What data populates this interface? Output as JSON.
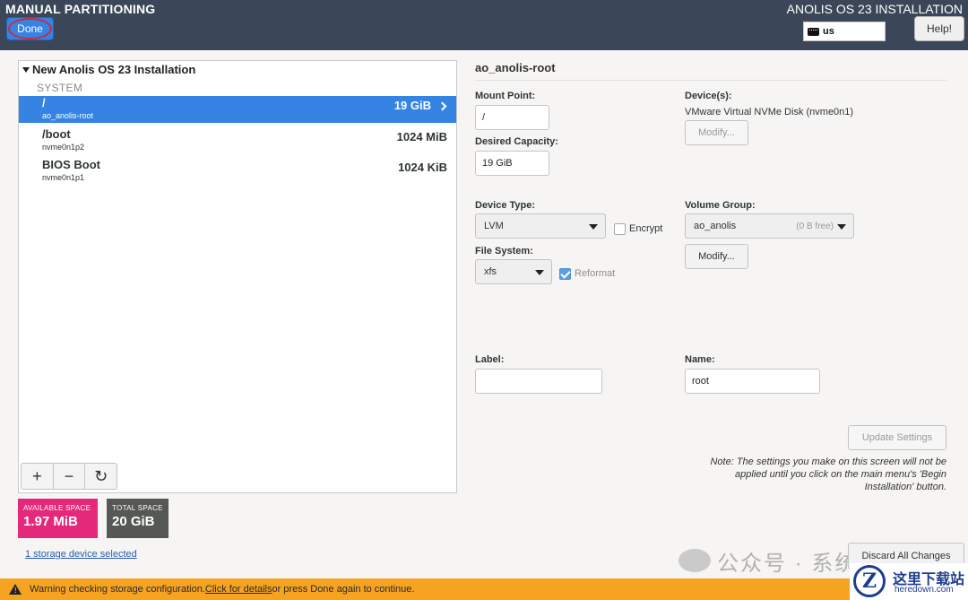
{
  "header": {
    "title": "MANUAL PARTITIONING",
    "product": "ANOLIS OS 23 INSTALLATION",
    "done_label": "Done",
    "keyboard_layout": "us",
    "help_label": "Help!"
  },
  "tree": {
    "title": "New Anolis OS 23 Installation",
    "group": "SYSTEM",
    "items": [
      {
        "mount": "/",
        "device": "ao_anolis-root",
        "size": "19 GiB",
        "selected": true
      },
      {
        "mount": "/boot",
        "device": "nvme0n1p2",
        "size": "1024 MiB",
        "selected": false
      },
      {
        "mount": "BIOS Boot",
        "device": "nvme0n1p1",
        "size": "1024 KiB",
        "selected": false
      }
    ]
  },
  "toolbar": {
    "add": "+",
    "remove": "−",
    "refresh": "↻"
  },
  "space": {
    "available_label": "AVAILABLE SPACE",
    "available_value": "1.97 MiB",
    "total_label": "TOTAL SPACE",
    "total_value": "20 GiB"
  },
  "storage_link": "1 storage device selected",
  "details": {
    "title": "ao_anolis-root",
    "mount_point_label": "Mount Point:",
    "mount_point_value": "/",
    "capacity_label": "Desired Capacity:",
    "capacity_value": "19 GiB",
    "devices_label": "Device(s):",
    "devices_value": "VMware Virtual NVMe Disk (nvme0n1)",
    "modify_devices_label": "Modify...",
    "device_type_label": "Device Type:",
    "device_type_value": "LVM",
    "encrypt_label": "Encrypt",
    "encrypt_checked": false,
    "volume_group_label": "Volume Group:",
    "volume_group_value": "ao_anolis",
    "volume_group_free": "(0 B free)",
    "modify_vg_label": "Modify...",
    "filesystem_label": "File System:",
    "filesystem_value": "xfs",
    "reformat_label": "Reformat",
    "reformat_checked": true,
    "label_label": "Label:",
    "label_value": "",
    "name_label": "Name:",
    "name_value": "root",
    "update_label": "Update Settings",
    "note": "Note:  The settings you make on this screen will not be applied until you click on the main menu's 'Begin Installation' button."
  },
  "discard_label": "Discard All Changes",
  "warning": {
    "prefix": "Warning checking storage configuration. ",
    "link": "Click for details",
    "suffix": " or press Done again to continue."
  },
  "watermark": {
    "text": "公众号 · 系统汇组"
  },
  "site_logo": {
    "letter": "Z",
    "cn": "这里下载站",
    "en": "heredown.com"
  },
  "colors": {
    "header": "#3b4758",
    "selection": "#3584e4",
    "available": "#e4287a",
    "total": "#555853",
    "warning": "#f6a322"
  }
}
